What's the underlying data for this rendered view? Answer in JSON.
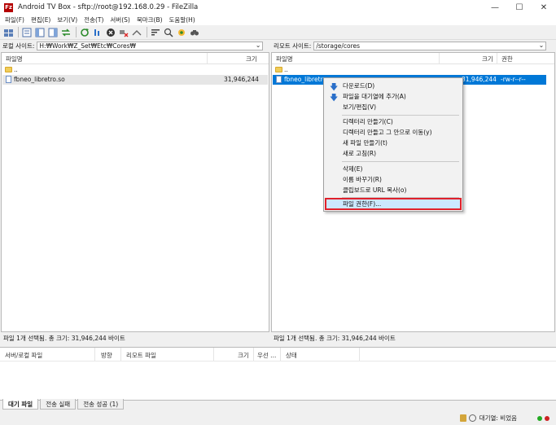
{
  "window": {
    "app_icon": "Fz",
    "title": "Android TV Box - sftp://root@192.168.0.29 - FileZilla",
    "minimize": "—",
    "maximize": "☐",
    "close": "✕"
  },
  "menu": [
    "파일(F)",
    "편집(E)",
    "보기(V)",
    "전송(T)",
    "서버(S)",
    "북마크(B)",
    "도움말(H)"
  ],
  "toolbar_icons": [
    "site-manager-icon",
    "toggle-log-icon",
    "toggle-local-tree-icon",
    "toggle-remote-tree-icon",
    "toggle-queue-icon",
    "refresh-icon",
    "process-queue-icon",
    "cancel-icon",
    "disconnect-icon",
    "reconnect-icon",
    "filter-icon",
    "compare-icon",
    "sync-browse-icon",
    "search-icon"
  ],
  "local": {
    "site_label": "로컬 사이트:",
    "path": "H:₩Work₩Z_Set₩Etc₩Cores₩",
    "col_name": "파일명",
    "col_size": "크기",
    "parent": "..",
    "files": [
      {
        "name": "fbneo_libretro.so",
        "size": "31,946,244"
      }
    ],
    "status": "파일 1개 선택됨. 총 크기: 31,946,244 바이트"
  },
  "remote": {
    "site_label": "리모트 사이트:",
    "path": "/storage/cores",
    "col_name": "파일명",
    "col_size": "크기",
    "col_perm": "권한",
    "parent": "..",
    "files": [
      {
        "name": "fbneo_libretro.so",
        "size": "31,946,244",
        "perm": "-rw-r--r--"
      }
    ],
    "status": "파일 1개 선택됨. 총 크기: 31,946,244 바이트"
  },
  "context_menu": {
    "download": "다운로드(D)",
    "add_queue": "파일을 대기열에 추가(A)",
    "view_edit": "보기/편집(V)",
    "mkdir": "디렉터리 만들기(C)",
    "mkdir_enter": "디렉터리 만들고 그 안으로 이동(y)",
    "new_file": "새 파일 만들기(t)",
    "refresh": "새로 고침(R)",
    "delete": "삭제(E)",
    "rename": "이름 바꾸기(R)",
    "copy_url": "클립보드로 URL 복사(o)",
    "permissions": "파일 권한(F)..."
  },
  "queue": {
    "col_server_local": "서버/로컬 파일",
    "col_direction": "방향",
    "col_remote": "리모트 파일",
    "col_size": "크기",
    "col_priority": "우선 ...",
    "col_status": "상태"
  },
  "tabs": [
    "대기 파일",
    "전송 실패",
    "전송 성공 (1)"
  ],
  "bottom_status": {
    "queue": "대기열: 비었음"
  },
  "colors": {
    "selection": "#0078d7",
    "highlight_border": "#e0212b",
    "led_green": "#22aa22",
    "led_red": "#cc2222"
  }
}
